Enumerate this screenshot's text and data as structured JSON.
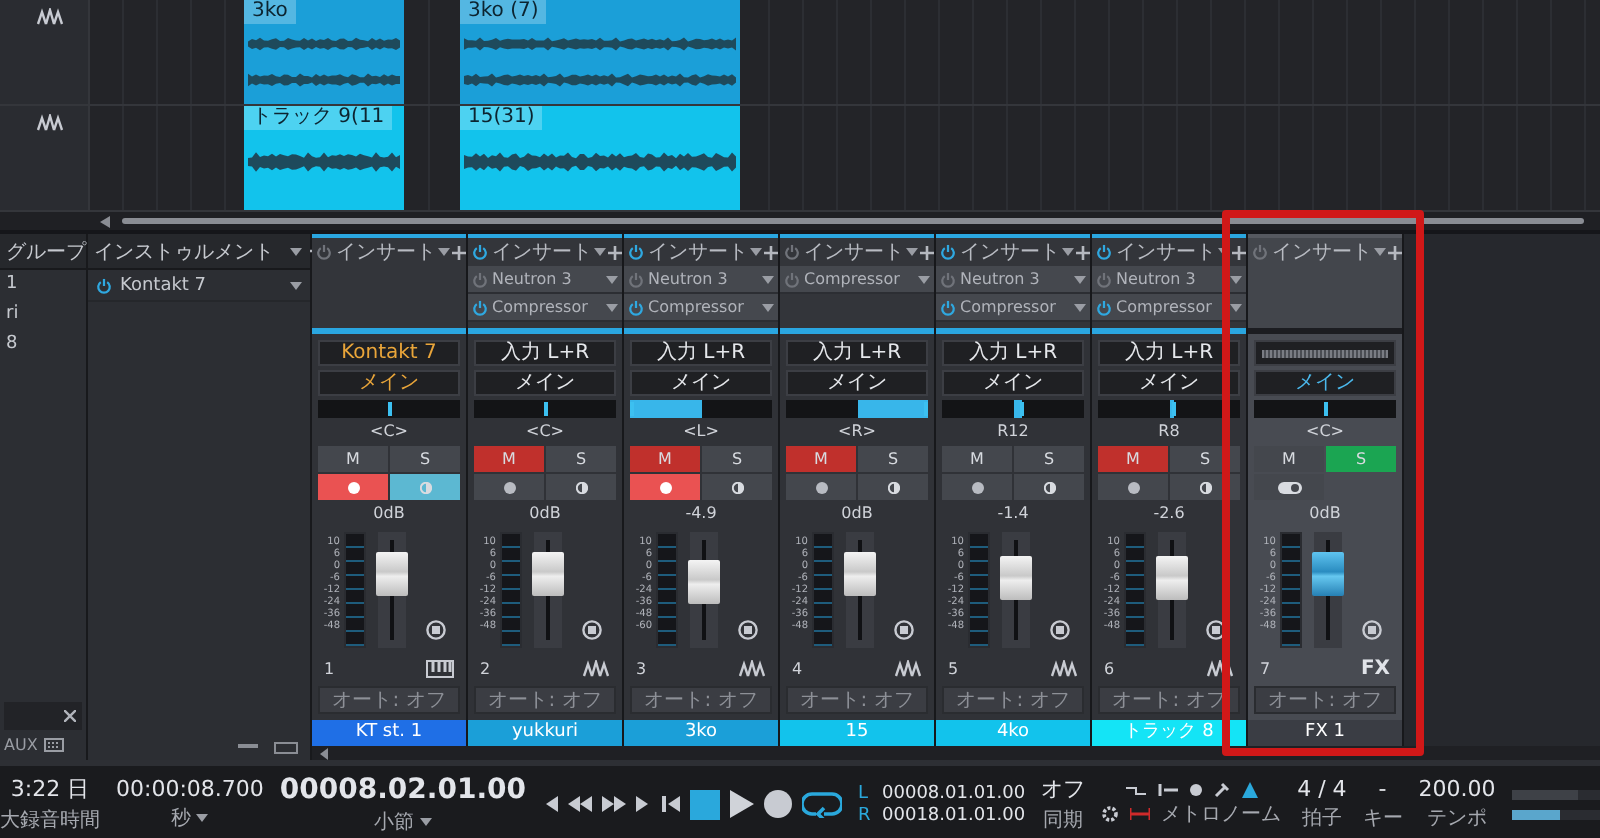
{
  "arrangement": {
    "lanes": [
      {
        "clips": [
          {
            "label": "3ko",
            "color": "#1b9fd8"
          },
          {
            "label": "3ko (7)",
            "color": "#1b9fd8"
          }
        ]
      },
      {
        "clips": [
          {
            "label": "トラック 9(11",
            "color": "#12c3ec"
          },
          {
            "label": "15(31)",
            "color": "#12c3ec"
          }
        ]
      }
    ]
  },
  "track_list": {
    "heading": "グループ",
    "items": [
      "1",
      "ri",
      "8"
    ]
  },
  "instruments": {
    "heading": "インストゥルメント",
    "items": [
      {
        "name": "Kontakt 7",
        "on": true
      }
    ]
  },
  "channels": [
    {
      "kind": "instrument",
      "insert_label": "インサート",
      "insert_on": false,
      "input": "Kontakt 7",
      "output": "メイン",
      "pan": {
        "label": "<C>",
        "level": 0.5
      },
      "mute": {
        "label": "M",
        "on": false
      },
      "solo": {
        "label": "S",
        "on": false
      },
      "record": true,
      "monitor": true,
      "volume": "0dB",
      "level": 0.72,
      "scale": [
        "10",
        "6",
        "0",
        "-6",
        "-12",
        "-24",
        "-36",
        "-48"
      ],
      "number": "1",
      "automation": "オート: オフ",
      "name": "KT st. 1",
      "color": "#1f6fe6",
      "highlighted": false
    },
    {
      "kind": "audio",
      "insert_label": "インサート",
      "insert_on": true,
      "inserts": [
        {
          "name": "Neutron 3",
          "on": false
        },
        {
          "name": "Compressor",
          "on": true
        }
      ],
      "input": "入力 L+R",
      "output": "メイン",
      "pan": {
        "label": "<C>",
        "level": 0.5
      },
      "mute": {
        "label": "M",
        "on": true
      },
      "solo": {
        "label": "S",
        "on": false
      },
      "record": false,
      "monitor": false,
      "volume": "0dB",
      "level": 0.72,
      "scale": [
        "10",
        "6",
        "0",
        "-6",
        "-12",
        "-24",
        "-36",
        "-48"
      ],
      "number": "2",
      "automation": "オート: オフ",
      "name": "yukkuri",
      "color": "#1b9fd8",
      "highlighted": false
    },
    {
      "kind": "audio",
      "insert_label": "インサート",
      "insert_on": true,
      "inserts": [
        {
          "name": "Neutron 3",
          "on": false
        },
        {
          "name": "Compressor",
          "on": true
        }
      ],
      "input": "入力 L+R",
      "output": "メイン",
      "pan": {
        "label": "<L>",
        "level": 0.0
      },
      "mute": {
        "label": "M",
        "on": true
      },
      "solo": {
        "label": "S",
        "on": false
      },
      "record": true,
      "monitor": false,
      "volume": "-4.9",
      "level": 0.6,
      "scale": [
        "10",
        "6",
        "0",
        "-6",
        "-24",
        "-36",
        "-48",
        "-60"
      ],
      "number": "3",
      "automation": "オート: オフ",
      "name": "3ko",
      "color": "#1b9fd8",
      "highlighted": false
    },
    {
      "kind": "audio",
      "insert_label": "インサート",
      "insert_on": false,
      "inserts": [
        {
          "name": "Compressor",
          "on": false
        }
      ],
      "input": "入力 L+R",
      "output": "メイン",
      "pan": {
        "label": "<R>",
        "level": 1.0
      },
      "mute": {
        "label": "M",
        "on": true
      },
      "solo": {
        "label": "S",
        "on": false
      },
      "record": false,
      "monitor": false,
      "volume": "0dB",
      "level": 0.72,
      "scale": [
        "10",
        "6",
        "0",
        "-6",
        "-12",
        "-24",
        "-36",
        "-48"
      ],
      "number": "4",
      "automation": "オート: オフ",
      "name": "15",
      "color": "#12c3ec",
      "highlighted": false
    },
    {
      "kind": "audio",
      "insert_label": "インサート",
      "insert_on": true,
      "inserts": [
        {
          "name": "Neutron 3",
          "on": false
        },
        {
          "name": "Compressor",
          "on": true
        }
      ],
      "input": "入力 L+R",
      "output": "メイン",
      "pan": {
        "label": "R12",
        "level": 0.56
      },
      "mute": {
        "label": "M",
        "on": false
      },
      "solo": {
        "label": "S",
        "on": false
      },
      "record": false,
      "monitor": false,
      "volume": "-1.4",
      "level": 0.68,
      "scale": [
        "10",
        "6",
        "0",
        "-6",
        "-12",
        "-24",
        "-36",
        "-48"
      ],
      "number": "5",
      "automation": "オート: オフ",
      "name": "4ko",
      "color": "#12c3ec",
      "highlighted": false
    },
    {
      "kind": "audio",
      "insert_label": "インサート",
      "insert_on": true,
      "inserts": [
        {
          "name": "Neutron 3",
          "on": false
        },
        {
          "name": "Compressor",
          "on": true
        }
      ],
      "input": "入力 L+R",
      "output": "メイン",
      "pan": {
        "label": "R8",
        "level": 0.54
      },
      "mute": {
        "label": "M",
        "on": true
      },
      "solo": {
        "label": "S",
        "on": false
      },
      "record": false,
      "monitor": false,
      "volume": "-2.6",
      "level": 0.66,
      "scale": [
        "10",
        "6",
        "0",
        "-6",
        "-12",
        "-24",
        "-36",
        "-48"
      ],
      "number": "6",
      "automation": "オート: オフ",
      "name": "トラック 8",
      "color": "#14e4f6",
      "highlighted": false
    },
    {
      "kind": "fx",
      "insert_label": "インサート",
      "insert_on": false,
      "output": "メイン",
      "pan": {
        "label": "<C>",
        "level": 0.5
      },
      "mute": {
        "label": "M",
        "on": false
      },
      "solo": {
        "label": "S",
        "on": true
      },
      "monitor": true,
      "volume": "0dB",
      "level": 0.72,
      "scale": [
        "10",
        "6",
        "0",
        "-6",
        "-12",
        "-24",
        "-36",
        "-48"
      ],
      "number": "7",
      "type_label": "FX",
      "automation": "オート: オフ",
      "name": "FX 1",
      "color": "#3a3d44",
      "highlighted": true
    }
  ],
  "mixer_tabs": [
    "AUX"
  ],
  "transport": {
    "clock": {
      "value": "3:22 日",
      "label": "大録音時間"
    },
    "time": {
      "value": "00:00:08.700",
      "label": "秒"
    },
    "position": {
      "value": "00008.02.01.00",
      "label": "小節"
    },
    "stopped": true,
    "loop_on": true,
    "locators": [
      {
        "label": "L",
        "value": "00008.01.01.00"
      },
      {
        "label": "R",
        "value": "00018.01.01.00"
      }
    ],
    "sync": {
      "value": "オフ",
      "label": "同期"
    },
    "metronome": {
      "label": "メトロノーム"
    },
    "signature": {
      "value": "4 / 4",
      "label": "拍子"
    },
    "key": {
      "value": "-",
      "label": "キー"
    },
    "tempo": {
      "value": "200.00",
      "label": "テンポ"
    },
    "meters": [
      {
        "level": 0.76
      },
      {
        "level": 0.56
      }
    ]
  }
}
